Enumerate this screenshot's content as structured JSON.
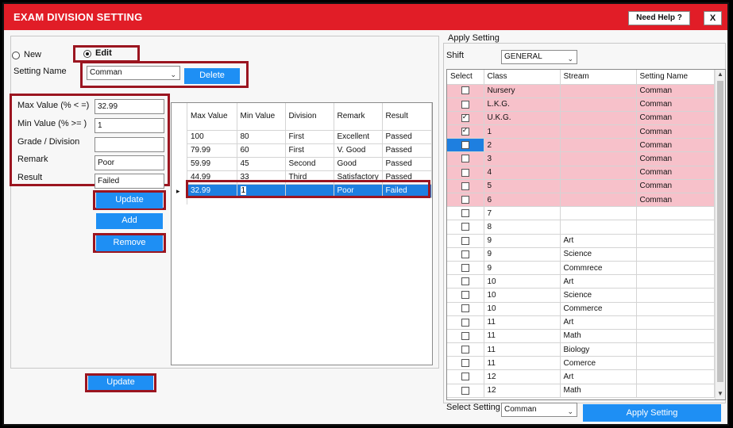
{
  "window": {
    "title": "EXAM DIVISION SETTING",
    "help_label": "Need Help ?",
    "close_label": "X"
  },
  "mode": {
    "new_label": "New",
    "edit_label": "Edit",
    "selected": "Edit"
  },
  "setting_name": {
    "label": "Setting Name",
    "value": "Comman",
    "delete_label": "Delete"
  },
  "form": {
    "max_label": "Max Value  (% < =)",
    "max_value": "32.99",
    "min_label": "Min Value   (% >= )",
    "min_value": "1",
    "grade_label": "Grade / Division",
    "grade_value": "",
    "remark_label": "Remark",
    "remark_value": "Poor",
    "result_label": "Result",
    "result_value": "Failed",
    "update_label": "Update",
    "add_label": "Add",
    "remove_label": "Remove"
  },
  "division_grid": {
    "columns": [
      "Max Value",
      "Min Value",
      "Division",
      "Remark",
      "Result"
    ],
    "rows": [
      [
        "100",
        "80",
        "First",
        "Excellent",
        "Passed"
      ],
      [
        "79.99",
        "60",
        "First",
        "V. Good",
        "Passed"
      ],
      [
        "59.99",
        "45",
        "Second",
        "Good",
        "Passed"
      ],
      [
        "44.99",
        "33",
        "Third",
        "Satisfactory",
        "Passed"
      ],
      [
        "32.99",
        "1",
        "",
        "Poor",
        "Failed"
      ]
    ],
    "selected_row": 4,
    "row_marker": "▸"
  },
  "bottom_update_label": "Update",
  "apply": {
    "group_label": "Apply Setting",
    "shift_label": "Shift",
    "shift_value": "GENERAL",
    "columns": [
      "Select",
      "Class",
      "Stream",
      "Setting Name"
    ],
    "rows": [
      {
        "checked": false,
        "class": "Nursery",
        "stream": "",
        "setting": "Comman",
        "pink": true
      },
      {
        "checked": false,
        "class": "L.K.G.",
        "stream": "",
        "setting": "Comman",
        "pink": true
      },
      {
        "checked": true,
        "class": "U.K.G.",
        "stream": "",
        "setting": "Comman",
        "pink": true
      },
      {
        "checked": true,
        "class": "1",
        "stream": "",
        "setting": "Comman",
        "pink": true
      },
      {
        "checked": false,
        "class": "2",
        "stream": "",
        "setting": "Comman",
        "pink": true,
        "current": true
      },
      {
        "checked": false,
        "class": "3",
        "stream": "",
        "setting": "Comman",
        "pink": true
      },
      {
        "checked": false,
        "class": "4",
        "stream": "",
        "setting": "Comman",
        "pink": true
      },
      {
        "checked": false,
        "class": "5",
        "stream": "",
        "setting": "Comman",
        "pink": true
      },
      {
        "checked": false,
        "class": "6",
        "stream": "",
        "setting": "Comman",
        "pink": true
      },
      {
        "checked": false,
        "class": "7",
        "stream": "",
        "setting": "",
        "pink": false
      },
      {
        "checked": false,
        "class": "8",
        "stream": "",
        "setting": "",
        "pink": false
      },
      {
        "checked": false,
        "class": "9",
        "stream": "Art",
        "setting": "",
        "pink": false
      },
      {
        "checked": false,
        "class": "9",
        "stream": "Science",
        "setting": "",
        "pink": false
      },
      {
        "checked": false,
        "class": "9",
        "stream": "Commrece",
        "setting": "",
        "pink": false
      },
      {
        "checked": false,
        "class": "10",
        "stream": "Art",
        "setting": "",
        "pink": false
      },
      {
        "checked": false,
        "class": "10",
        "stream": "Science",
        "setting": "",
        "pink": false
      },
      {
        "checked": false,
        "class": "10",
        "stream": "Commerce",
        "setting": "",
        "pink": false
      },
      {
        "checked": false,
        "class": "11",
        "stream": "Art",
        "setting": "",
        "pink": false
      },
      {
        "checked": false,
        "class": "11",
        "stream": "Math",
        "setting": "",
        "pink": false
      },
      {
        "checked": false,
        "class": "11",
        "stream": "Biology",
        "setting": "",
        "pink": false
      },
      {
        "checked": false,
        "class": "11",
        "stream": "Comerce",
        "setting": "",
        "pink": false
      },
      {
        "checked": false,
        "class": "12",
        "stream": "Art",
        "setting": "",
        "pink": false
      },
      {
        "checked": false,
        "class": "12",
        "stream": "Math",
        "setting": "",
        "pink": false
      }
    ],
    "select_setting_label": "Select Setting",
    "select_setting_value": "Comman",
    "apply_label": "Apply Setting"
  },
  "colors": {
    "title_red": "#e11d27",
    "button_blue": "#1e8ff4",
    "highlight_red": "#9b1520",
    "pink_row": "#f7c1ca",
    "selection_blue": "#1e7fe0"
  }
}
